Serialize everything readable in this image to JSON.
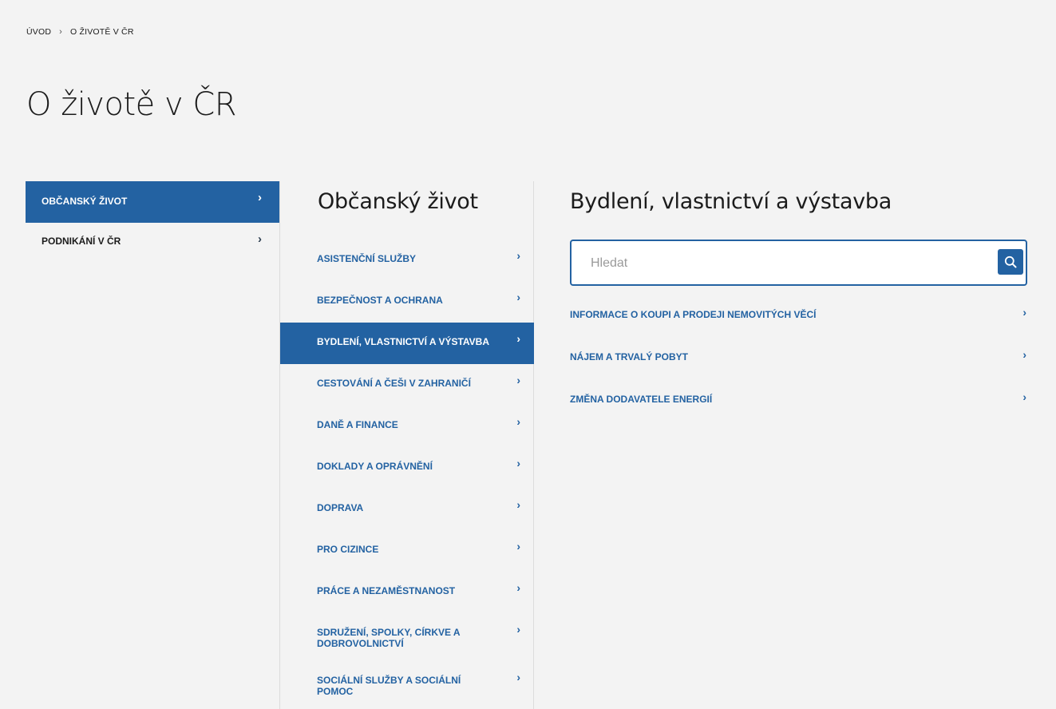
{
  "breadcrumb": {
    "home": "ÚVOD",
    "separator": "›",
    "current": "O ŽIVOTĚ V ČR"
  },
  "page_title": "O životě v ČR",
  "chevron": "›",
  "level1": {
    "items": [
      {
        "label": "OBČANSKÝ ŽIVOT",
        "active": true
      },
      {
        "label": "PODNIKÁNÍ V ČR",
        "active": false
      }
    ]
  },
  "level2": {
    "heading": "Občanský život",
    "items": [
      {
        "label": "ASISTENČNÍ SLUŽBY"
      },
      {
        "label": "BEZPEČNOST A OCHRANA"
      },
      {
        "label": "BYDLENÍ, VLASTNICTVÍ A VÝSTAVBA",
        "active": true
      },
      {
        "label": "CESTOVÁNÍ A ČEŠI V ZAHRANIČÍ"
      },
      {
        "label": "DANĚ A FINANCE"
      },
      {
        "label": "DOKLADY A OPRÁVNĚNÍ"
      },
      {
        "label": "DOPRAVA"
      },
      {
        "label": "PRO CIZINCE"
      },
      {
        "label": "PRÁCE A NEZAMĚSTNANOST"
      },
      {
        "label": "SDRUŽENÍ, SPOLKY, CÍRKVE A DOBROVOLNICTVÍ"
      },
      {
        "label": "SOCIÁLNÍ SLUŽBY A SOCIÁLNÍ POMOC"
      }
    ]
  },
  "level3": {
    "heading": "Bydlení, vlastnictví a výstavba",
    "search": {
      "placeholder": "Hledat",
      "value": "",
      "icon": "search-icon"
    },
    "items": [
      {
        "label": "INFORMACE O KOUPI A PRODEJI NEMOVITÝCH VĚCÍ"
      },
      {
        "label": "NÁJEM A TRVALÝ POBYT"
      },
      {
        "label": "ZMĚNA DODAVATELE ENERGIÍ"
      }
    ]
  },
  "colors": {
    "accent": "#2362a2",
    "background": "#f3f3f3",
    "text": "#1b1b1b"
  }
}
